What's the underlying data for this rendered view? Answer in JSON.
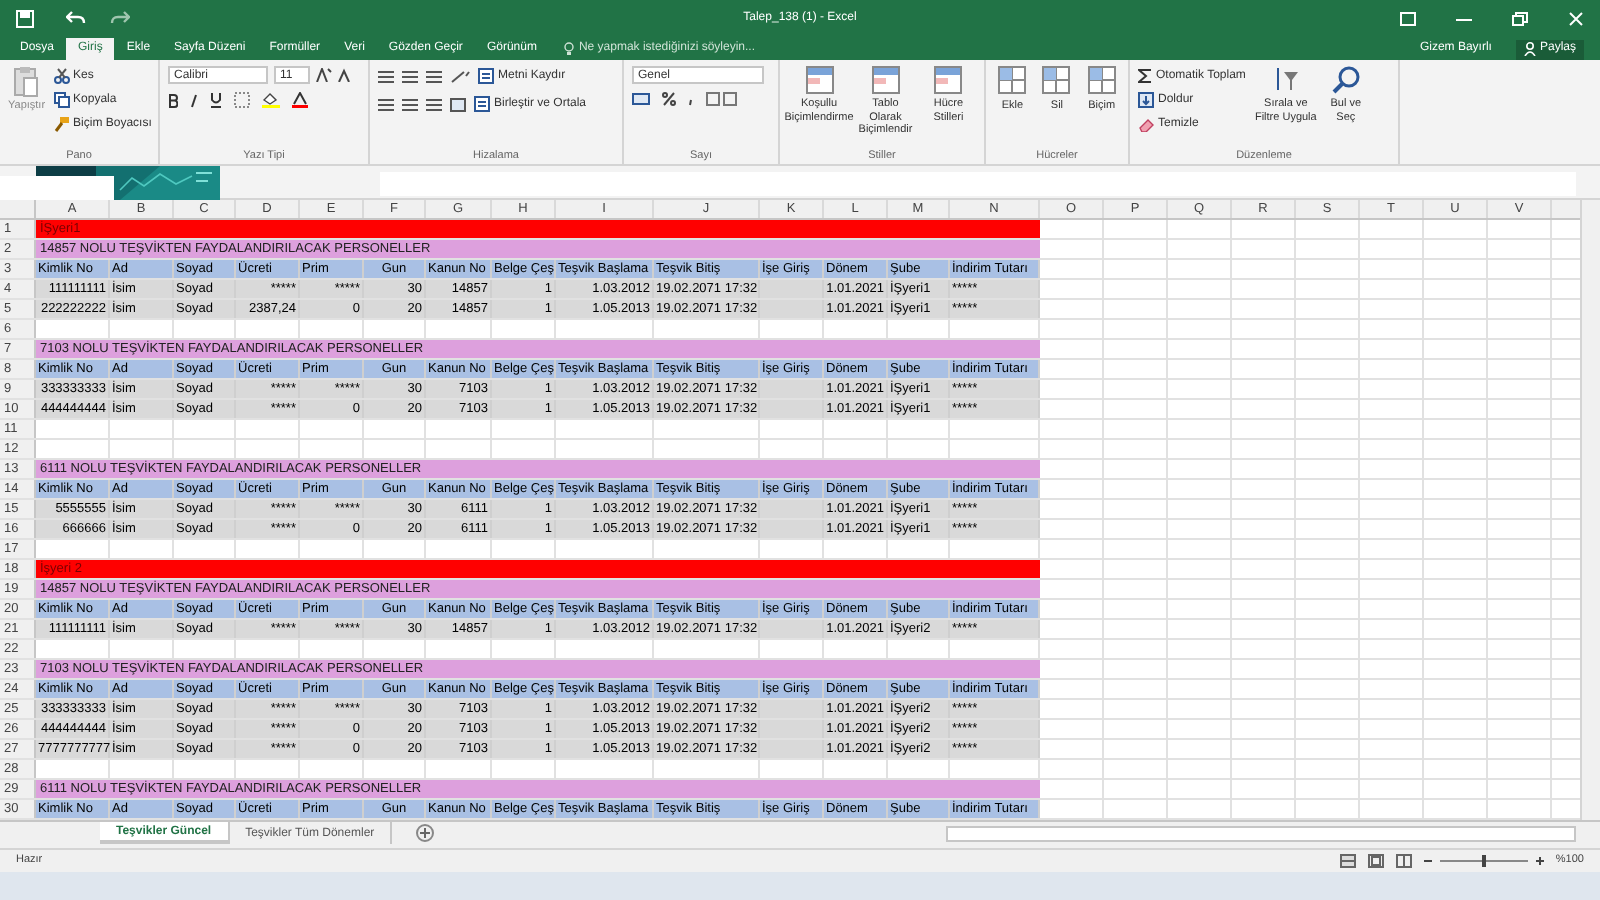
{
  "window": {
    "title": "Talep_138 (1) - Excel",
    "user": "Gizem Bayırlı",
    "share": "Paylaş"
  },
  "ribbon_tabs": [
    {
      "label": "Dosya",
      "selected": false
    },
    {
      "label": "Giriş",
      "selected": true
    },
    {
      "label": "Ekle",
      "selected": false
    },
    {
      "label": "Sayfa Düzeni",
      "selected": false
    },
    {
      "label": "Formüller",
      "selected": false
    },
    {
      "label": "Veri",
      "selected": false
    },
    {
      "label": "Gözden Geçir",
      "selected": false
    },
    {
      "label": "Görünüm",
      "selected": false
    }
  ],
  "tell_me": "Ne yapmak istediğinizi söyleyin...",
  "ribbon": {
    "clipboard": {
      "paste": "Yapıştır",
      "cut": "Kes",
      "copy": "Kopyala",
      "format_painter": "Biçim Boyacısı",
      "label": "Pano"
    },
    "font": {
      "name": "Calibri",
      "size": "11",
      "label": "Yazı Tipi"
    },
    "alignment": {
      "wrap": "Metni Kaydır",
      "merge": "Birleştir ve Ortala",
      "label": "Hizalama"
    },
    "number": {
      "format": "Genel",
      "label": "Sayı"
    },
    "styles": {
      "buttons": [
        "Koşullu Biçimlendirme",
        "Tablo Olarak Biçimlendir",
        "Hücre Stilleri"
      ],
      "label": "Stiller"
    },
    "cells": {
      "buttons": [
        "Ekle",
        "Sil",
        "Biçim"
      ],
      "label": "Hücreler"
    },
    "editing": {
      "autosum": "Otomatik Toplam",
      "fill": "Doldur",
      "clear": "Temizle",
      "sort": "Sırala ve Filtre Uygula",
      "find": "Bul ve Seç",
      "label": "Düzenleme"
    }
  },
  "sheet": {
    "columns": [
      "A",
      "B",
      "C",
      "D",
      "E",
      "F",
      "G",
      "H",
      "I",
      "J",
      "K",
      "L",
      "M",
      "N",
      "O",
      "P",
      "Q",
      "R",
      "S",
      "T",
      "U",
      "V"
    ],
    "rows": [
      {
        "number": "1",
        "kind": "title",
        "text": "İŞyeri1"
      },
      {
        "number": "2",
        "kind": "section",
        "text": "14857 NOLU TEŞVİKTEN FAYDALANDIRILACAK PERSONELLER"
      },
      {
        "number": "3",
        "kind": "header",
        "cells": [
          "Kimlik No",
          "Ad",
          "Soyad",
          "Ücreti",
          "Prim",
          "Gun",
          "Kanun No",
          "Belge Çeş",
          "Teşvik Başlama",
          "Teşvik Bitiş",
          "İşe Giriş",
          "Dönem",
          "Şube",
          "İndirim Tutarı"
        ]
      },
      {
        "number": "4",
        "kind": "data",
        "cells": [
          "111111111",
          "İsim",
          "Soyad",
          "*****",
          "*****",
          "30",
          "14857",
          "1",
          "1.03.2012",
          "19.02.2071 17:32",
          null,
          "1.01.2021",
          "İŞyeri1",
          "*****"
        ]
      },
      {
        "number": "5",
        "kind": "data",
        "cells": [
          "222222222",
          "İsim",
          "Soyad",
          "2387,24",
          "0",
          "20",
          "14857",
          "1",
          "1.05.2013",
          "19.02.2071 17:32",
          null,
          "1.01.2021",
          "İŞyeri1",
          "*****"
        ]
      },
      {
        "number": "6",
        "kind": "empty"
      },
      {
        "number": "7",
        "kind": "section",
        "text": "7103 NOLU TEŞVİKTEN FAYDALANDIRILACAK PERSONELLER"
      },
      {
        "number": "8",
        "kind": "header",
        "cells": [
          "Kimlik No",
          "Ad",
          "Soyad",
          "Ücreti",
          "Prim",
          "Gun",
          "Kanun No",
          "Belge Çeş",
          "Teşvik Başlama",
          "Teşvik Bitiş",
          "İşe Giriş",
          "Dönem",
          "Şube",
          "İndirim Tutarı"
        ]
      },
      {
        "number": "9",
        "kind": "data",
        "cells": [
          "333333333",
          "İsim",
          "Soyad",
          "*****",
          "*****",
          "30",
          "7103",
          "1",
          "1.03.2012",
          "19.02.2071 17:32",
          null,
          "1.01.2021",
          "İŞyeri1",
          "*****"
        ]
      },
      {
        "number": "10",
        "kind": "data",
        "cells": [
          "444444444",
          "İsim",
          "Soyad",
          "*****",
          "0",
          "20",
          "7103",
          "1",
          "1.05.2013",
          "19.02.2071 17:32",
          null,
          "1.01.2021",
          "İŞyeri1",
          "*****"
        ]
      },
      {
        "number": "11",
        "kind": "empty"
      },
      {
        "number": "12",
        "kind": "empty"
      },
      {
        "number": "13",
        "kind": "section",
        "text": "6111 NOLU TEŞVİKTEN FAYDALANDIRILACAK PERSONELLER"
      },
      {
        "number": "14",
        "kind": "header",
        "cells": [
          "Kimlik No",
          "Ad",
          "Soyad",
          "Ücreti",
          "Prim",
          "Gun",
          "Kanun No",
          "Belge Çeş",
          "Teşvik Başlama",
          "Teşvik Bitiş",
          "İşe Giriş",
          "Dönem",
          "Şube",
          "İndirim Tutarı"
        ]
      },
      {
        "number": "15",
        "kind": "data",
        "cells": [
          "5555555",
          "İsim",
          "Soyad",
          "*****",
          "*****",
          "30",
          "6111",
          "1",
          "1.03.2012",
          "19.02.2071 17:32",
          null,
          "1.01.2021",
          "İŞyeri1",
          "*****"
        ]
      },
      {
        "number": "16",
        "kind": "data",
        "cells": [
          "666666",
          "İsim",
          "Soyad",
          "*****",
          "0",
          "20",
          "6111",
          "1",
          "1.05.2013",
          "19.02.2071 17:32",
          null,
          "1.01.2021",
          "İŞyeri1",
          "*****"
        ]
      },
      {
        "number": "17",
        "kind": "empty"
      },
      {
        "number": "18",
        "kind": "title",
        "text": "İşyeri 2"
      },
      {
        "number": "19",
        "kind": "section",
        "text": "14857 NOLU TEŞVİKTEN FAYDALANDIRILACAK PERSONELLER"
      },
      {
        "number": "20",
        "kind": "header",
        "cells": [
          "Kimlik No",
          "Ad",
          "Soyad",
          "Ücreti",
          "Prim",
          "Gun",
          "Kanun No",
          "Belge Çeş",
          "Teşvik Başlama",
          "Teşvik Bitiş",
          "İşe Giriş",
          "Dönem",
          "Şube",
          "İndirim Tutarı"
        ]
      },
      {
        "number": "21",
        "kind": "data",
        "cells": [
          "111111111",
          "İsim",
          "Soyad",
          "*****",
          "*****",
          "30",
          "14857",
          "1",
          "1.03.2012",
          "19.02.2071 17:32",
          null,
          "1.01.2021",
          "İŞyeri2",
          "*****"
        ]
      },
      {
        "number": "22",
        "kind": "empty"
      },
      {
        "number": "23",
        "kind": "section",
        "text": "7103 NOLU TEŞVİKTEN FAYDALANDIRILACAK PERSONELLER"
      },
      {
        "number": "24",
        "kind": "header",
        "cells": [
          "Kimlik No",
          "Ad",
          "Soyad",
          "Ücreti",
          "Prim",
          "Gun",
          "Kanun No",
          "Belge Çeş",
          "Teşvik Başlama",
          "Teşvik Bitiş",
          "İşe Giriş",
          "Dönem",
          "Şube",
          "İndirim Tutarı"
        ]
      },
      {
        "number": "25",
        "kind": "data",
        "cells": [
          "333333333",
          "İsim",
          "Soyad",
          "*****",
          "*****",
          "30",
          "7103",
          "1",
          "1.03.2012",
          "19.02.2071 17:32",
          null,
          "1.01.2021",
          "İŞyeri2",
          "*****"
        ]
      },
      {
        "number": "26",
        "kind": "data",
        "cells": [
          "444444444",
          "İsim",
          "Soyad",
          "*****",
          "0",
          "20",
          "7103",
          "1",
          "1.05.2013",
          "19.02.2071 17:32",
          null,
          "1.01.2021",
          "İŞyeri2",
          "*****"
        ]
      },
      {
        "number": "27",
        "kind": "data",
        "cells": [
          "7777777777",
          "İsim",
          "Soyad",
          "*****",
          "0",
          "20",
          "7103",
          "1",
          "1.05.2013",
          "19.02.2071 17:32",
          null,
          "1.01.2021",
          "İŞyeri2",
          "*****"
        ]
      },
      {
        "number": "28",
        "kind": "empty"
      },
      {
        "number": "29",
        "kind": "section",
        "text": "6111 NOLU TEŞVİKTEN FAYDALANDIRILACAK PERSONELLER"
      },
      {
        "number": "30",
        "kind": "header",
        "cells": [
          "Kimlik No",
          "Ad",
          "Soyad",
          "Ücreti",
          "Prim",
          "Gun",
          "Kanun No",
          "Belge Çeş",
          "Teşvik Başlama",
          "Teşvik Bitiş",
          "İşe Giriş",
          "Dönem",
          "Şube",
          "İndirim Tutarı"
        ]
      }
    ]
  },
  "sheet_tabs": [
    {
      "label": "Teşvikler Güncel",
      "selected": true
    },
    {
      "label": "Teşvikler Tüm Dönemler",
      "selected": false
    }
  ],
  "status_bar": {
    "text": "Hazır",
    "zoom": "%100"
  }
}
